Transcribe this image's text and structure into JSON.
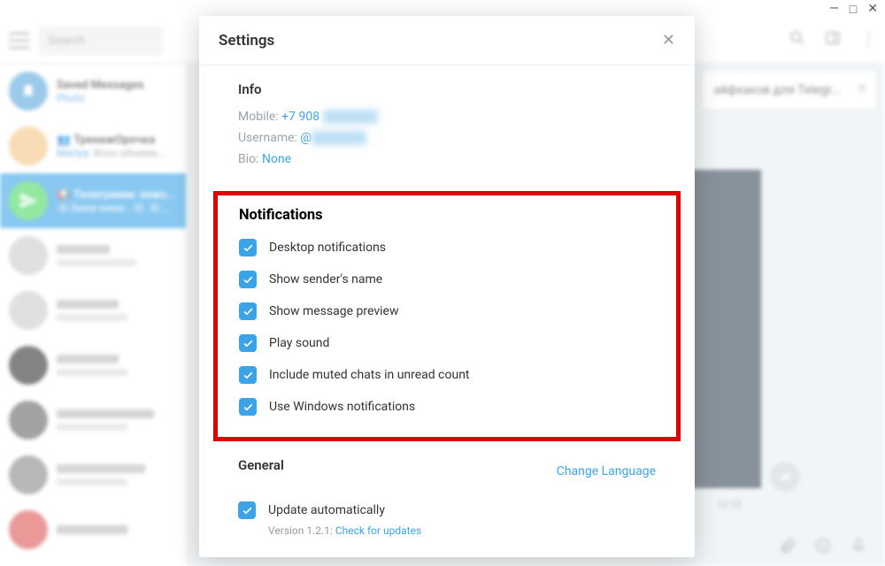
{
  "window_controls": {
    "minimize": "—",
    "maximize": "□",
    "close": "✕"
  },
  "bg": {
    "search_placeholder": "Search",
    "chats": [
      {
        "title": "Saved Messages",
        "sub_label": "Photo",
        "avatar": "blue"
      },
      {
        "title": "👥 ТренажОрочка",
        "sub_prefix": "Mariya:",
        "sub": " Всех обнима...",
        "avatar": "orange"
      },
      {
        "title": "📢 Телеграмм: ново...",
        "sub": "❄️Зима-зима...❄️ ❄️...",
        "avatar": "green",
        "selected": true
      }
    ],
    "banner": "айфхаков для Telegr...",
    "time": "12:12"
  },
  "modal": {
    "title": "Settings",
    "info": {
      "heading": "Info",
      "mobile_label": "Mobile: ",
      "mobile_value": "+7 908",
      "username_label": "Username: ",
      "username_prefix": "@",
      "bio_label": "Bio: ",
      "bio_value": "None"
    },
    "notifications": {
      "heading": "Notifications",
      "items": [
        {
          "label": "Desktop notifications",
          "checked": true
        },
        {
          "label": "Show sender's name",
          "checked": true
        },
        {
          "label": "Show message preview",
          "checked": true
        },
        {
          "label": "Play sound",
          "checked": true
        },
        {
          "label": "Include muted chats in unread count",
          "checked": true
        },
        {
          "label": "Use Windows notifications",
          "checked": true
        }
      ]
    },
    "general": {
      "heading": "General",
      "change_language": "Change Language",
      "update_label": "Update automatically",
      "version_prefix": "Version 1.2.1: ",
      "check_updates": "Check for updates"
    }
  }
}
